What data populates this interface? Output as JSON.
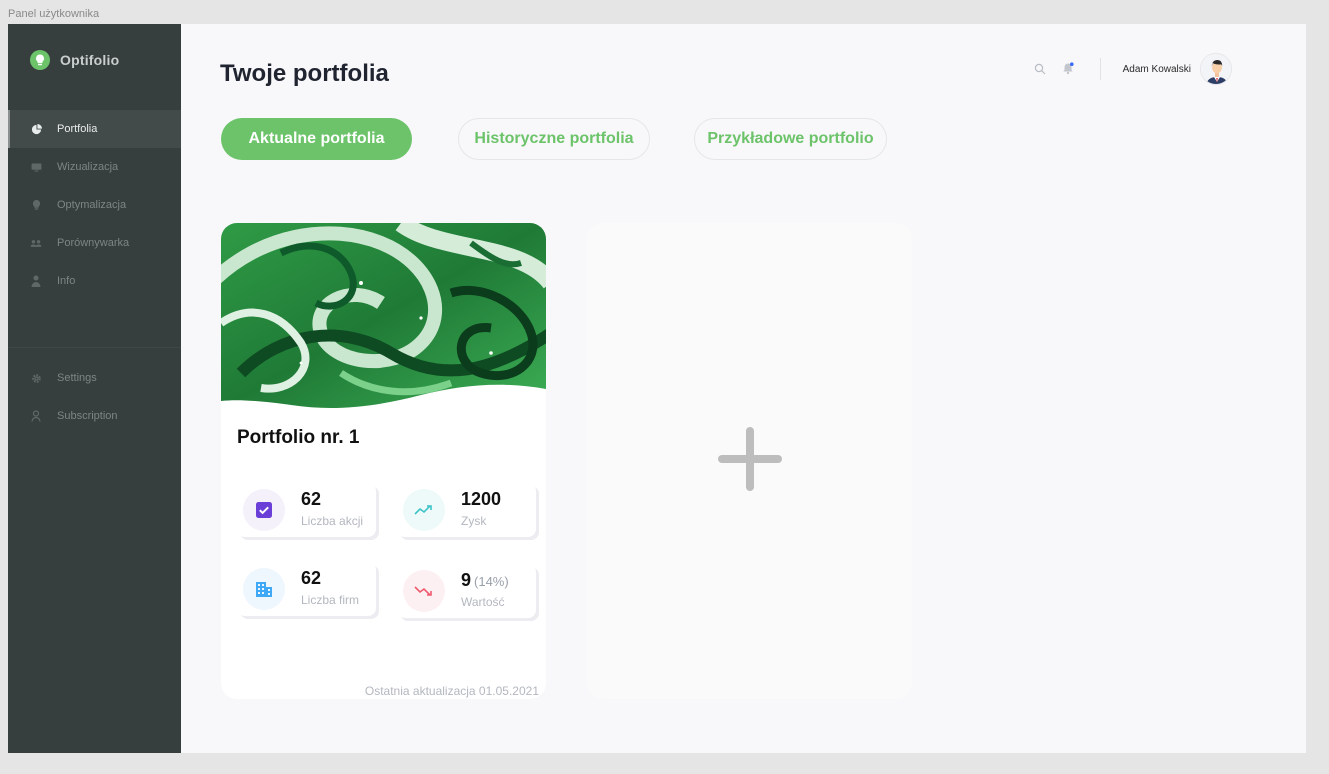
{
  "frame": {
    "label": "Panel użytkownika"
  },
  "brand": {
    "name": "Optifolio",
    "accent": "#6cc36a"
  },
  "sidebar": {
    "items": [
      {
        "label": "Portfolia",
        "icon": "pie-chart-icon",
        "active": true
      },
      {
        "label": "Wizualizacja",
        "icon": "monitor-icon"
      },
      {
        "label": "Optymalizacja",
        "icon": "lightbulb-icon"
      },
      {
        "label": "Porównywarka",
        "icon": "users-icon"
      },
      {
        "label": "Info",
        "icon": "person-icon"
      }
    ],
    "secondary": [
      {
        "label": "Settings",
        "icon": "gear-icon"
      },
      {
        "label": "Subscription",
        "icon": "user-outline-icon"
      }
    ]
  },
  "header": {
    "title": "Twoje portfolia",
    "user_name": "Adam Kowalski"
  },
  "tabs": [
    {
      "label": "Aktualne portfolia",
      "active": true
    },
    {
      "label": "Historyczne portfolia"
    },
    {
      "label": "Przykładowe portfolio"
    }
  ],
  "portfolio_card": {
    "title": "Portfolio nr. 1",
    "stats": [
      {
        "value": "62",
        "label": "Liczba akcji",
        "icon": "checkbox-icon"
      },
      {
        "value": "1200",
        "label": "Zysk",
        "icon": "trend-up-icon"
      },
      {
        "value": "62",
        "label": "Liczba firm",
        "icon": "building-icon"
      },
      {
        "value": "9",
        "extra": "(14%)",
        "label": "Wartość",
        "icon": "trend-down-icon"
      }
    ],
    "footer": "Ostatnia aktualizacja 01.05.2021"
  },
  "colors": {
    "sidebar_bg": "#363f3e",
    "accent_green": "#6cc36a",
    "purple": "#6a3fd8",
    "teal": "#3bc3c6",
    "blue": "#3fa9f5",
    "red": "#ef5a6f"
  }
}
